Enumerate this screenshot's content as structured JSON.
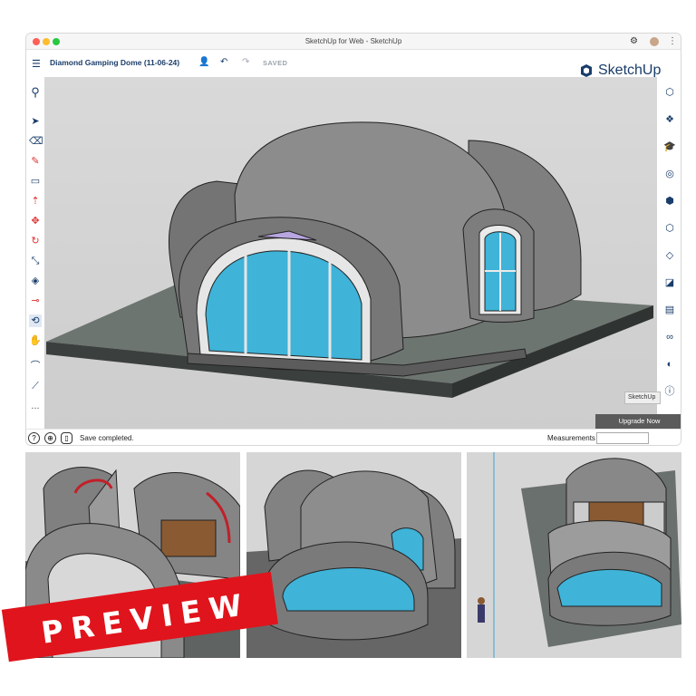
{
  "window": {
    "title": "SketchUp for Web - SketchUp"
  },
  "app": {
    "document_title": "Diamond Gamping Dome (11-06-24)",
    "saved_label": "SAVED",
    "logo_text": "SketchUp"
  },
  "toolbar_left": {
    "tools": [
      "search-tool",
      "select-tool",
      "eraser-tool",
      "pencil-tool",
      "rectangle-tool",
      "push-pull-tool",
      "move-tool",
      "rotate-tool",
      "scale-tool",
      "paint-tool",
      "tape-measure-tool",
      "orbit-tool",
      "pan-tool",
      "arc-tool",
      "line-tool"
    ],
    "more_label": "..."
  },
  "toolbar_right": {
    "panels": [
      "entity-info-icon",
      "components-icon",
      "materials-icon",
      "styles-icon",
      "layers-icon",
      "scenes-icon",
      "eraser-panel-icon",
      "shadows-icon",
      "outliner-icon",
      "view-icon",
      "display-icon",
      "info-icon"
    ]
  },
  "status": {
    "text": "Save completed.",
    "measurements_label": "Measurements",
    "upgrade_label": "Upgrade Now",
    "sketchup_tag": "SketchUp"
  },
  "preview": {
    "label": "PREVIEW"
  },
  "colors": {
    "brand": "#1a3d6a",
    "glass": "#3fb3d8",
    "dome": "#8a8a8a",
    "banner": "#e0141c"
  }
}
